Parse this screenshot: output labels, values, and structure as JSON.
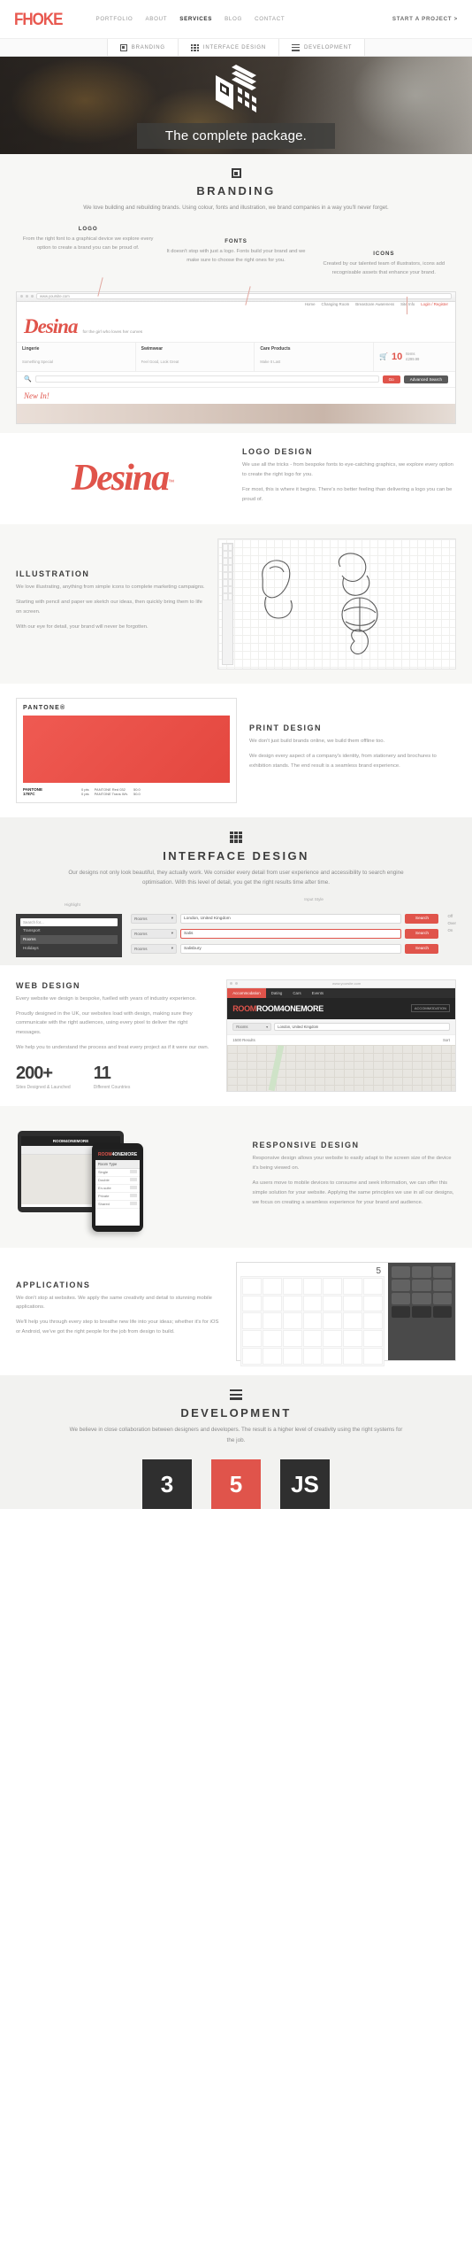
{
  "header": {
    "logo": "FHOKE",
    "nav": [
      {
        "label": "PORTFOLIO",
        "active": false
      },
      {
        "label": "ABOUT",
        "active": false
      },
      {
        "label": "SERVICES",
        "active": true
      },
      {
        "label": "BLOG",
        "active": false
      },
      {
        "label": "CONTACT",
        "active": false
      }
    ],
    "cta": "START A PROJECT >"
  },
  "tabs": [
    {
      "label": "BRANDING",
      "icon": "square-dot-icon"
    },
    {
      "label": "INTERFACE DESIGN",
      "icon": "grid-nine-icon"
    },
    {
      "label": "DEVELOPMENT",
      "icon": "stacked-bars-icon"
    }
  ],
  "hero": {
    "headline": "The complete package.",
    "icon": "isometric-cube-icon"
  },
  "branding": {
    "icon": "square-dot-icon",
    "title": "BRANDING",
    "intro": "We love building and rebuilding brands. Using colour, fonts and illustration, we brand companies in a way you'll never forget.",
    "columns": [
      {
        "title": "LOGO",
        "body": "From the right font to a graphical device we explore every option to create a brand you can be proud of."
      },
      {
        "title": "FONTS",
        "body": "It doesn't stop with just a logo. Fonts build your brand and we make sure to choose the right ones for you."
      },
      {
        "title": "ICONS",
        "body": "Created by our talented team of illustrators, icons add recognisable assets that enhance your brand."
      }
    ]
  },
  "desina_browser": {
    "url": "www.yoursite.com",
    "brand": "Desina",
    "tagline": "for the girl who loves her curves",
    "nav": [
      "Home",
      "Changing Room",
      "Breastcare Awareness",
      "Site Info",
      "Login / Register"
    ],
    "categories": [
      {
        "title": "Lingerie",
        "sub": "Something Special"
      },
      {
        "title": "Swimwear",
        "sub": "Feel Good, Look Great"
      },
      {
        "title": "Care Products",
        "sub": "Make It Last"
      }
    ],
    "cart": {
      "count": "10",
      "line1": "Items",
      "line2": "£299.99"
    },
    "search_button": "Go",
    "advanced_button": "Advanced Search",
    "new_in": "New In!"
  },
  "logo_design": {
    "wordmark": "Desina",
    "title": "LOGO DESIGN",
    "body1": "We use all the tricks - from bespoke fonts to eye-catching graphics, we explore every option to create the right logo for you.",
    "body2": "For most, this is where it begins. There's no better feeling than delivering a logo you can be proud of."
  },
  "illustration": {
    "title": "ILLUSTRATION",
    "body1": "We love illustrating, anything from simple icons to complete marketing campaigns.",
    "body2": "Starting with pencil and paper we sketch our ideas, then quickly bring them to life on screen.",
    "body3": "With our eye for detail, your brand will never be forgotten."
  },
  "print_design": {
    "pantone_header": "PANTONE®",
    "pantone_code": "PANTONE\n1787C",
    "pantone_name": "PANTONE",
    "pantone_num": "1787C",
    "swatch_rows": [
      {
        "pct": "0 pts",
        "name": "PANTONE Red 032",
        "val": "50.0"
      },
      {
        "pct": "0 pts",
        "name": "PANTONE Trans Wh.",
        "val": "50.0"
      }
    ],
    "title": "PRINT DESIGN",
    "body1": "We don't just build brands online, we build them offline too.",
    "body2": "We design every aspect of a company's identity, from stationery and brochures to exhibition stands. The end result is a seamless brand experience."
  },
  "interface_design": {
    "icon": "grid-nine-icon",
    "title": "INTERFACE DESIGN",
    "intro": "Our designs not only look beautiful, they actually work. We consider every detail from user experience and accessibility to search engine optimisation. With this level of detail, you get the right results time after time.",
    "annotations": {
      "highlight": "Highlight",
      "input_style": "Input Style",
      "off": "Off",
      "over": "Over",
      "on": "On"
    },
    "dark_panel": {
      "search_placeholder": "Search for...",
      "options": [
        "Transport",
        "Rooms",
        "Holidays"
      ],
      "selected": "Rooms"
    },
    "form_rows": [
      {
        "select": "Rooms",
        "value": "London, United Kingdom",
        "button": "Search",
        "state": "default"
      },
      {
        "select": "Rooms",
        "value": "Salis",
        "button": "Search",
        "state": "error"
      },
      {
        "select": "Rooms",
        "value": "Salisbury",
        "button": "Search",
        "state": "active"
      }
    ]
  },
  "web_design": {
    "title": "WEB DESIGN",
    "body1": "Every website we design is bespoke, fuelled with years of industry experience.",
    "body2": "Proudly designed in the UK, our websites load with design, making sure they communicate with the right audiences, using every pixel to deliver the right messages.",
    "body3": "We help you to understand the process and treat every project as if it were our own.",
    "stats": [
      {
        "num": "200+",
        "label": "Sites Designed & Launched"
      },
      {
        "num": "11",
        "label": "Different Countries"
      }
    ],
    "mock": {
      "url": "www.yoursite.com",
      "nav": [
        "Accommodation",
        "Dating",
        "Cars",
        "Events"
      ],
      "active_nav": "Accommodation",
      "brand": "ROOM4ONEMORE",
      "badge": "ACCOMMODATION",
      "select": "Rooms",
      "search_value": "London, United Kingdom",
      "results": "1500 Results",
      "sort": "Sort"
    }
  },
  "responsive_design": {
    "title": "RESPONSIVE DESIGN",
    "body1": "Responsive design allows your website to easily adapt to the screen size of the device it's being viewed on.",
    "body2": "As users move to mobile devices to consume and seek information, we can offer this simple solution for your website. Applying the same principles we use in all our designs, we focus on creating a seamless experience for your brand and audience.",
    "tablet_brand": "ROOM4ONEMORE",
    "phone_brand": "ROOM4ONEMORE",
    "phone_header": "Room Type",
    "phone_options": [
      "Single",
      "Double",
      "En-suite",
      "Private",
      "Shared"
    ]
  },
  "applications": {
    "title": "APPLICATIONS",
    "body1": "We don't stop at websites. We apply the same creativity and detail to stunning mobile applications.",
    "body2": "We'll help you through every step to breathe new life into your ideas; whether it's for iOS or Android, we've got the right people for the job from design to build.",
    "calendar_number": "5"
  },
  "development": {
    "icon": "stacked-bars-icon",
    "title": "DEVELOPMENT",
    "intro": "We believe in close collaboration between designers and developers. The result is a higher level of creativity using the right systems for the job.",
    "tech": [
      {
        "label": "3",
        "name": "css3-icon"
      },
      {
        "label": "5",
        "name": "html5-icon"
      },
      {
        "label": "JS",
        "name": "javascript-icon"
      }
    ]
  },
  "colors": {
    "accent": "#e0544b",
    "dark": "#3d3d3d",
    "muted": "#949494"
  }
}
